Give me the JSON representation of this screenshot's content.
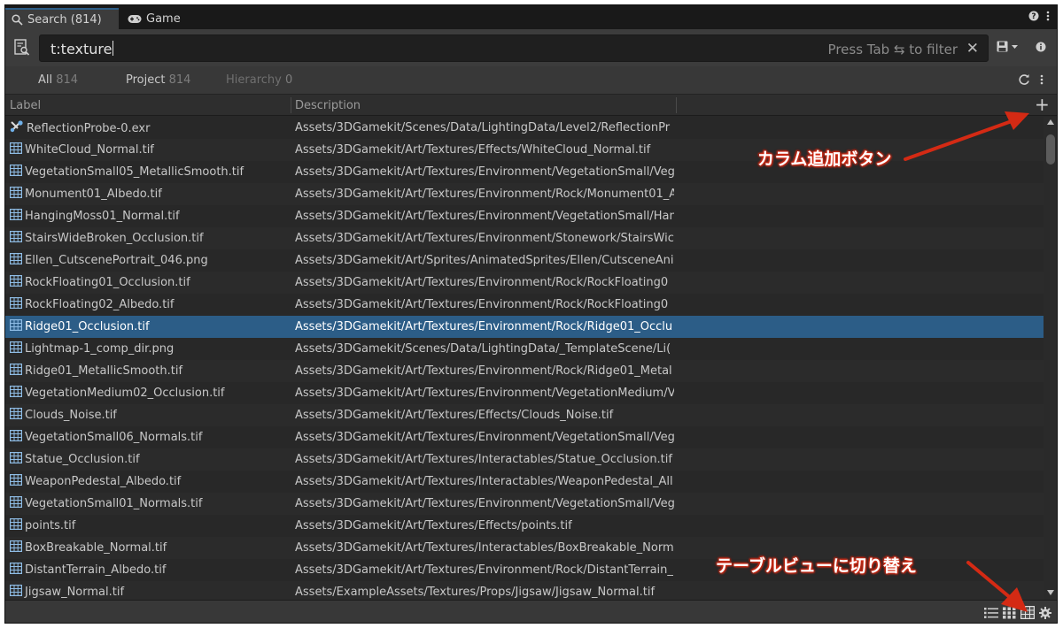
{
  "tabs": [
    {
      "label": "Search (814)",
      "icon": "magnifier-icon",
      "active": true
    },
    {
      "label": "Game",
      "icon": "gamepad-icon",
      "active": false
    }
  ],
  "search": {
    "value": "t:texture",
    "hint": "Press Tab ⇆ to filter",
    "clear": "✕"
  },
  "filters": [
    {
      "label": "All",
      "count": "814"
    },
    {
      "label": "Project",
      "count": "814"
    },
    {
      "label": "Hierarchy",
      "count": "0"
    }
  ],
  "columns": {
    "label": "Label",
    "description": "Description",
    "add": "+"
  },
  "rows": [
    {
      "icon": "reflection-probe-icon",
      "label": "ReflectionProbe-0.exr",
      "desc": "Assets/3DGamekit/Scenes/Data/LightingData/Level2/ReflectionPr"
    },
    {
      "icon": "texture-icon",
      "label": "WhiteCloud_Normal.tif",
      "desc": "Assets/3DGamekit/Art/Textures/Effects/WhiteCloud_Normal.tif"
    },
    {
      "icon": "texture-icon",
      "label": "VegetationSmall05_MetallicSmooth.tif",
      "desc": "Assets/3DGamekit/Art/Textures/Environment/VegetationSmall/Veg"
    },
    {
      "icon": "texture-icon",
      "label": "Monument01_Albedo.tif",
      "desc": "Assets/3DGamekit/Art/Textures/Environment/Rock/Monument01_A"
    },
    {
      "icon": "texture-icon",
      "label": "HangingMoss01_Normal.tif",
      "desc": "Assets/3DGamekit/Art/Textures/Environment/VegetationSmall/Han"
    },
    {
      "icon": "texture-icon",
      "label": "StairsWideBroken_Occlusion.tif",
      "desc": "Assets/3DGamekit/Art/Textures/Environment/Stonework/StairsWic"
    },
    {
      "icon": "texture-icon",
      "label": "Ellen_CutscenePortrait_046.png",
      "desc": "Assets/3DGamekit/Art/Sprites/AnimatedSprites/Ellen/CutsceneAni"
    },
    {
      "icon": "texture-icon",
      "label": "RockFloating01_Occlusion.tif",
      "desc": "Assets/3DGamekit/Art/Textures/Environment/Rock/RockFloating0"
    },
    {
      "icon": "texture-icon",
      "label": "RockFloating02_Albedo.tif",
      "desc": "Assets/3DGamekit/Art/Textures/Environment/Rock/RockFloating0"
    },
    {
      "icon": "texture-icon",
      "label": "Ridge01_Occlusion.tif",
      "desc": "Assets/3DGamekit/Art/Textures/Environment/Rock/Ridge01_Occlu",
      "selected": true
    },
    {
      "icon": "texture-icon",
      "label": "Lightmap-1_comp_dir.png",
      "desc": "Assets/3DGamekit/Scenes/Data/LightingData/_TemplateScene/Li("
    },
    {
      "icon": "texture-icon",
      "label": "Ridge01_MetallicSmooth.tif",
      "desc": "Assets/3DGamekit/Art/Textures/Environment/Rock/Ridge01_Metal"
    },
    {
      "icon": "texture-icon",
      "label": "VegetationMedium02_Occlusion.tif",
      "desc": "Assets/3DGamekit/Art/Textures/Environment/VegetationMedium/V"
    },
    {
      "icon": "texture-icon",
      "label": "Clouds_Noise.tif",
      "desc": "Assets/3DGamekit/Art/Textures/Effects/Clouds_Noise.tif"
    },
    {
      "icon": "texture-icon",
      "label": "VegetationSmall06_Normals.tif",
      "desc": "Assets/3DGamekit/Art/Textures/Environment/VegetationSmall/Veg"
    },
    {
      "icon": "texture-icon",
      "label": "Statue_Occlusion.tif",
      "desc": "Assets/3DGamekit/Art/Textures/Interactables/Statue_Occlusion.tif"
    },
    {
      "icon": "texture-icon",
      "label": "WeaponPedestal_Albedo.tif",
      "desc": "Assets/3DGamekit/Art/Textures/Interactables/WeaponPedestal_All"
    },
    {
      "icon": "texture-icon",
      "label": "VegetationSmall01_Normals.tif",
      "desc": "Assets/3DGamekit/Art/Textures/Environment/VegetationSmall/Veg"
    },
    {
      "icon": "texture-icon",
      "label": "points.tif",
      "desc": "Assets/3DGamekit/Art/Textures/Effects/points.tif"
    },
    {
      "icon": "texture-icon",
      "label": "BoxBreakable_Normal.tif",
      "desc": "Assets/3DGamekit/Art/Textures/Interactables/BoxBreakable_Norm"
    },
    {
      "icon": "texture-icon",
      "label": "DistantTerrain_Albedo.tif",
      "desc": "Assets/3DGamekit/Art/Textures/Environment/Rock/DistantTerrain_"
    },
    {
      "icon": "texture-icon",
      "label": "Jigsaw_Normal.tif",
      "desc": "Assets/ExampleAssets/Textures/Props/Jigsaw/Jigsaw_Normal.tif"
    }
  ],
  "statusbar": {
    "view_icons": [
      "list-view-icon",
      "grid-view-icon",
      "table-view-icon",
      "settings-gear-icon"
    ]
  },
  "annotations": {
    "add_column": "カラム追加ボタン",
    "table_view": "テーブルビューに切り替え"
  },
  "colors": {
    "selection": "#2c5d87",
    "annotation": "#d42a14",
    "panel": "#282828"
  }
}
